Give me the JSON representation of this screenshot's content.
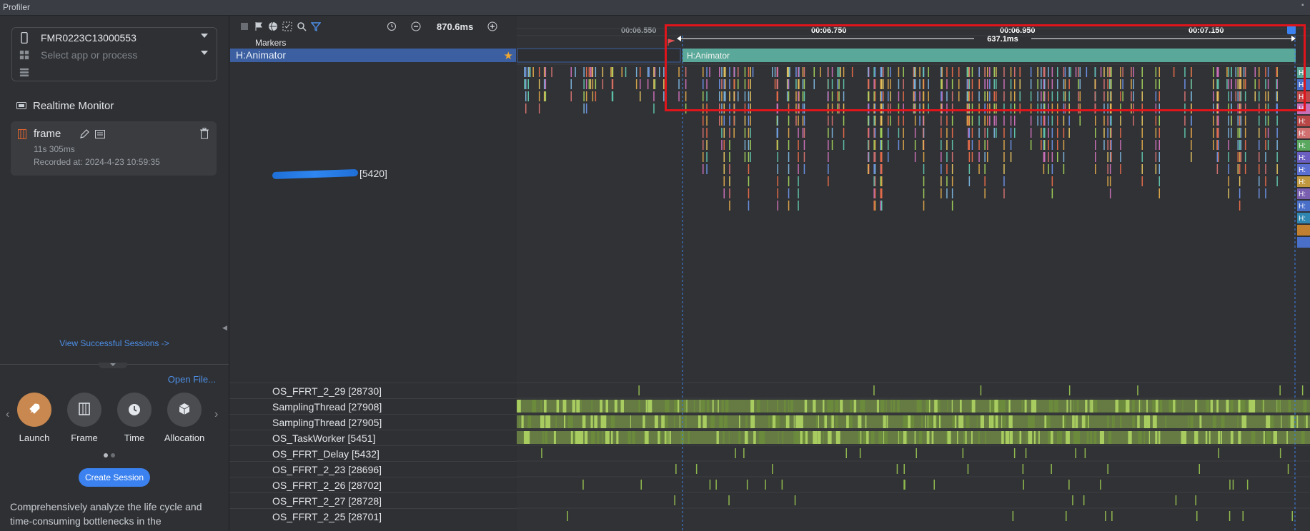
{
  "window": {
    "title": "Profiler"
  },
  "device": {
    "name": "FMR0223C13000553",
    "process_placeholder": "Select app or process"
  },
  "realtime": {
    "title": "Realtime Monitor"
  },
  "session": {
    "name": "frame",
    "duration": "11s 305ms",
    "recorded": "Recorded at: 2024-4-23 10:59:35"
  },
  "links": {
    "view_sessions": "View Successful Sessions ->",
    "open_file": "Open File..."
  },
  "templates": [
    {
      "label": "Launch",
      "icon": "rocket-icon"
    },
    {
      "label": "Frame",
      "icon": "frame-icon"
    },
    {
      "label": "Time",
      "icon": "clock-icon"
    },
    {
      "label": "Allocation",
      "icon": "cube-icon"
    }
  ],
  "buttons": {
    "create_session": "Create Session"
  },
  "description": "Comprehensively analyze the life cycle and time-consuming bottlenecks in the",
  "toolbar": {
    "zoom": "870.6ms"
  },
  "ruler": {
    "ticks": [
      {
        "label": "00:06.550",
        "highlighted": false
      },
      {
        "label": "00:06.750",
        "highlighted": true
      },
      {
        "label": "00:06.950",
        "highlighted": true
      },
      {
        "label": "00:07.150",
        "highlighted": true
      }
    ],
    "range_label": "637.1ms"
  },
  "tracks": {
    "markers_label": "Markers",
    "pinned": {
      "name": "H:Animator",
      "slice": "H:Animator"
    },
    "process_label": "[5420]",
    "threads": [
      "OS_FFRT_2_29 [28730]",
      "SamplingThread [27908]",
      "SamplingThread [27905]",
      "OS_TaskWorker [5451]",
      "OS_FFRT_Delay [5432]",
      "OS_FFRT_2_23 [28696]",
      "OS_FFRT_2_26 [28702]",
      "OS_FFRT_2_27 [28728]",
      "OS_FFRT_2_25 [28701]"
    ],
    "right_slice_label": "H:"
  },
  "colors": {
    "accent": "#3b82f0",
    "highlight_box": "#e0151c",
    "animator_slice": "#5aa89a",
    "cpu_green": "#8fb84e",
    "pinned_row": "#3b5fa0"
  }
}
